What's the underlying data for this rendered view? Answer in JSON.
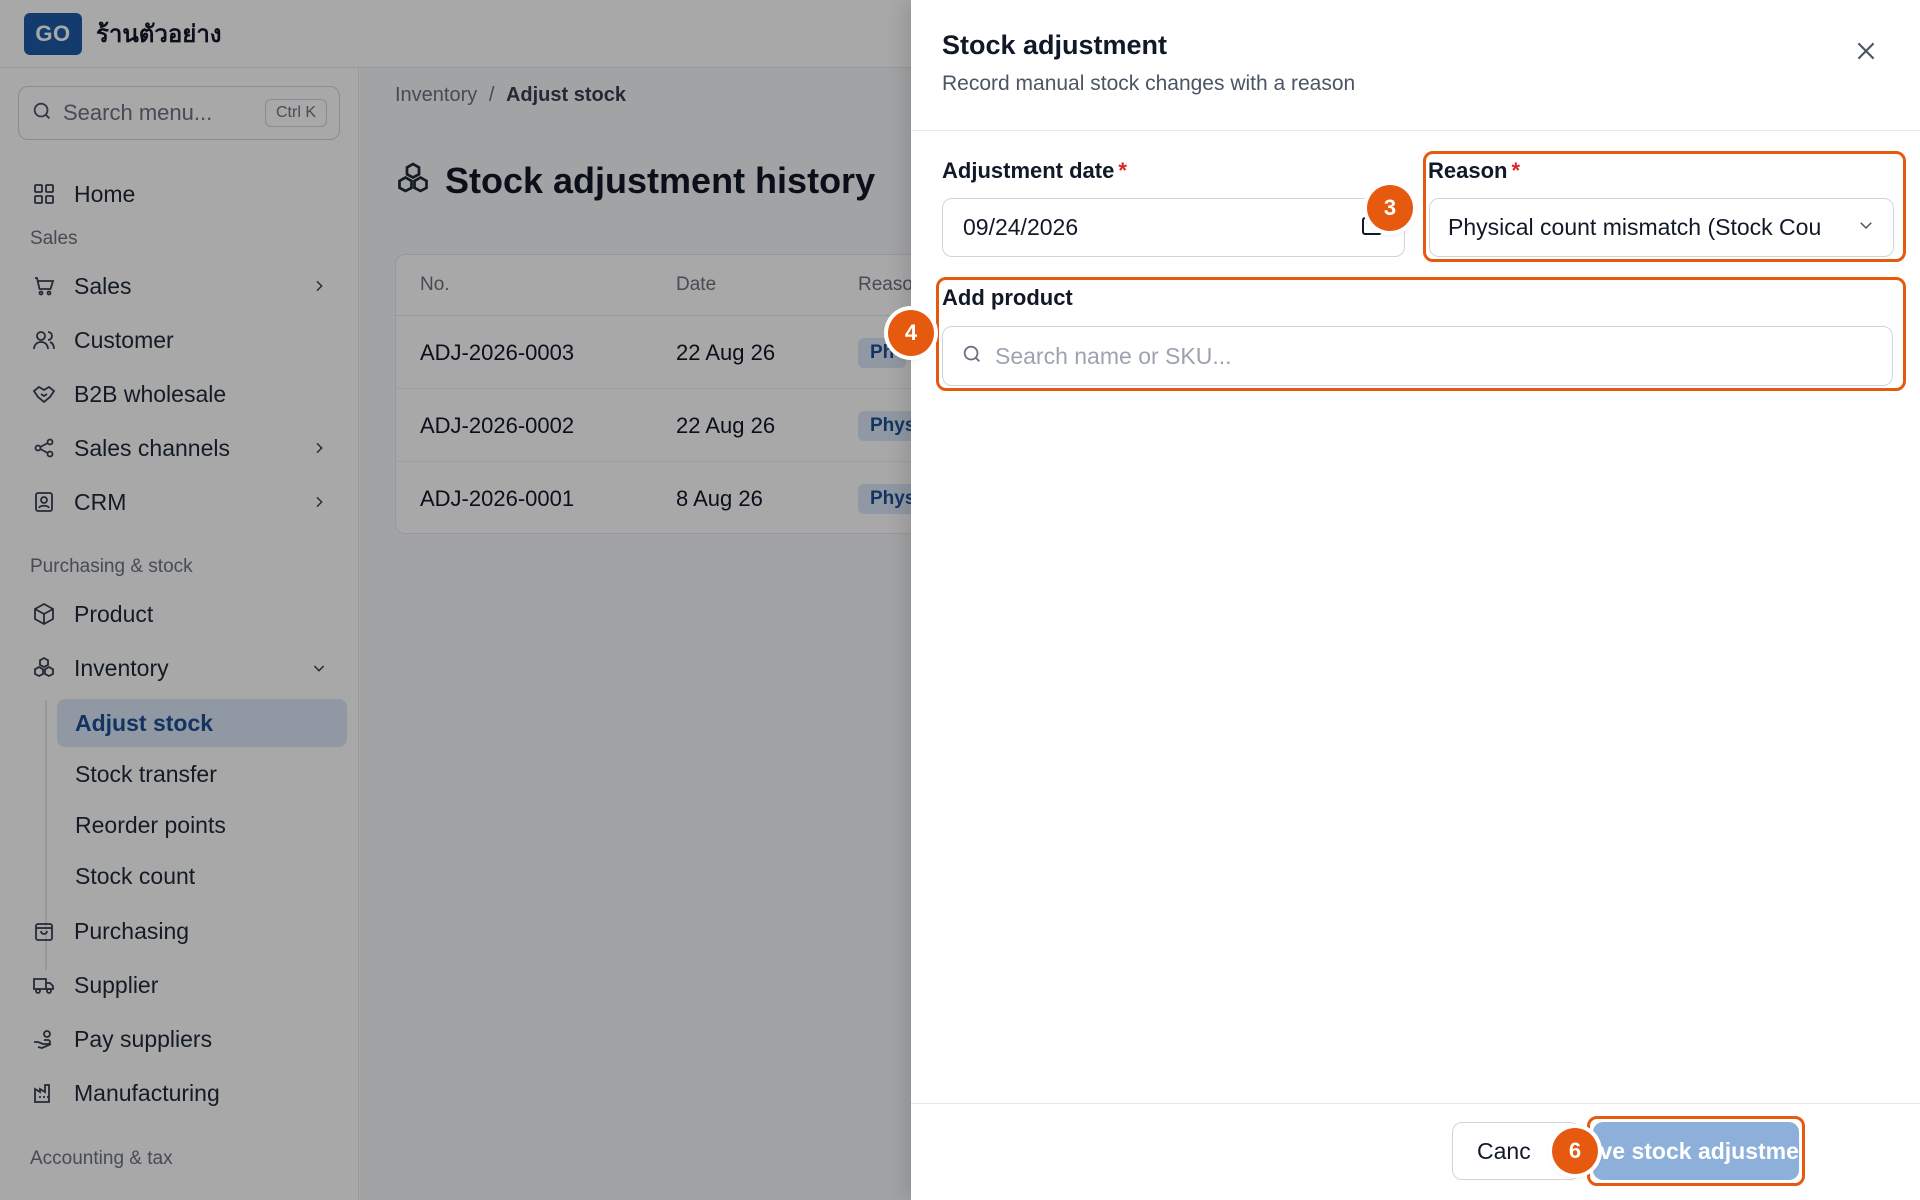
{
  "app": {
    "logo_text": "GO",
    "shop_name": "ร้านตัวอย่าง"
  },
  "sidebar": {
    "search_placeholder": "Search menu...",
    "search_shortcut": "Ctrl K",
    "home": "Home",
    "sections": {
      "sales": "Sales",
      "purchasing_stock": "Purchasing & stock",
      "accounting": "Accounting & tax"
    },
    "items": {
      "sales": "Sales",
      "customer": "Customer",
      "b2b": "B2B wholesale",
      "channels": "Sales channels",
      "crm": "CRM",
      "product": "Product",
      "inventory": "Inventory",
      "purchasing": "Purchasing",
      "supplier": "Supplier",
      "pay_suppliers": "Pay suppliers",
      "manufacturing": "Manufacturing"
    },
    "inventory_sub": [
      "Adjust stock",
      "Stock transfer",
      "Reorder points",
      "Stock count"
    ]
  },
  "main": {
    "breadcrumb": {
      "parent": "Inventory",
      "sep": "/",
      "current": "Adjust stock"
    },
    "title": "Stock adjustment history",
    "table": {
      "headers": {
        "no": "No.",
        "date": "Date",
        "reason": "Reaso"
      },
      "rows": [
        {
          "no": "ADJ-2026-0003",
          "date": "22 Aug 26",
          "reason": "Ph"
        },
        {
          "no": "ADJ-2026-0002",
          "date": "22 Aug 26",
          "reason": "Phys"
        },
        {
          "no": "ADJ-2026-0001",
          "date": "8 Aug 26",
          "reason": "Phys"
        }
      ]
    }
  },
  "drawer": {
    "title": "Stock adjustment",
    "subtitle": "Record manual stock changes with a reason",
    "date_label": "Adjustment date",
    "date_value": "09/24/2026",
    "required_mark": "*",
    "reason_label": "Reason",
    "reason_value": "Physical count mismatch (Stock Cou",
    "add_product_label": "Add product",
    "product_search_placeholder": "Search name or SKU...",
    "cancel_label": "Canc",
    "save_label": "Save stock adjustment",
    "steps": {
      "reason": "3",
      "product": "4",
      "save": "6"
    }
  },
  "colors": {
    "brand": "#1e5aa8",
    "highlight": "#e55a0f",
    "save_button": "#8db0da",
    "active_nav_bg": "#dbe7f7"
  }
}
